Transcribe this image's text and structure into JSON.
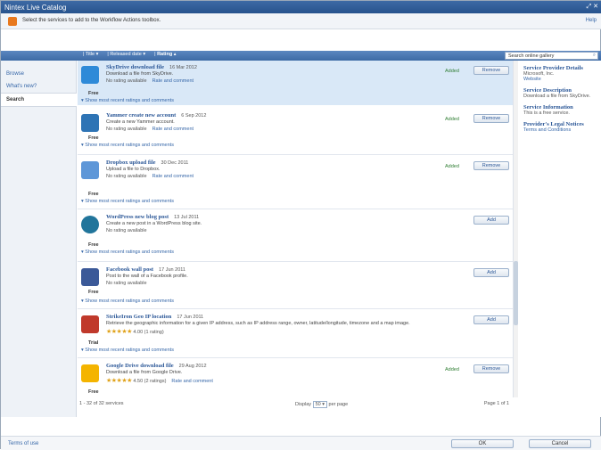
{
  "window": {
    "title": "Nintex Live Catalog",
    "instruction": "Select the services to add to the Workflow Actions toolbox.",
    "help": "Help"
  },
  "sort_bar": {
    "title": "Title",
    "released": "Released date",
    "rating": "Rating"
  },
  "search": {
    "placeholder": "Search online gallery"
  },
  "nav": [
    "Browse",
    "What's new?",
    "Search"
  ],
  "items": [
    {
      "name": "SkyDrive download file",
      "date": "16 Mar 2012",
      "desc": "Download a file from SkyDrive.",
      "rating_text": "No rating available",
      "rate_link": "Rate and comment",
      "price": "Free",
      "more": "Show most recent ratings and comments",
      "added": "Added",
      "button": "Remove",
      "color": "#2e8ad8"
    },
    {
      "name": "Yammer create new account",
      "date": "6 Sep 2012",
      "desc": "Create a new Yammer account.",
      "rating_text": "No rating available",
      "rate_link": "Rate and comment",
      "price": "Free",
      "more": "Show most recent ratings and comments",
      "added": "Added",
      "button": "Remove",
      "color": "#2e74b5"
    },
    {
      "name": "Dropbox upload file",
      "date": "30 Dec 2011",
      "desc": "Upload a file to Dropbox.",
      "rating_text": "No rating available",
      "rate_link": "Rate and comment",
      "price": "Free",
      "more": "Show most recent ratings and comments",
      "added": "Added",
      "button": "Remove",
      "color": "#5e97d8"
    },
    {
      "name": "WordPress new blog post",
      "date": "13 Jul 2011",
      "desc": "Create a new post in a WordPress blog site.",
      "rating_text": "No rating available",
      "rate_link": "",
      "price": "Free",
      "more": "Show most recent ratings and comments",
      "added": "",
      "button": "Add",
      "color": "#21759b"
    },
    {
      "name": "Facebook wall post",
      "date": "17 Jun 2011",
      "desc": "Post to the wall of a Facebook profile.",
      "rating_text": "No rating available",
      "rate_link": "",
      "price": "Free",
      "more": "Show most recent ratings and comments",
      "added": "",
      "button": "Add",
      "color": "#3b5998"
    },
    {
      "name": "StrikeIron Geo IP location",
      "date": "17 Jun 2011",
      "desc": "Retrieve the geographic information for a given IP address, such as IP address range, owner, latitude/longitude, timezone and a map image.",
      "rating_text": "4.00 (1 rating)",
      "stars": "★★★★★",
      "rate_link": "",
      "price": "Trial",
      "more": "Show most recent ratings and comments",
      "added": "",
      "button": "Add",
      "color": "#c0392b"
    },
    {
      "name": "Google Drive download file",
      "date": "29 Aug 2012",
      "desc": "Download a file from Google Drive.",
      "rating_text": "4.50 (2 ratings)",
      "stars": "★★★★★",
      "rate_link": "Rate and comment",
      "price": "Free",
      "more": "",
      "added": "Added",
      "button": "Remove",
      "color": "#f4b400"
    }
  ],
  "right_panel": {
    "provider_title": "Service Provider Details",
    "provider": "Microsoft, Inc.",
    "website": "Website",
    "desc_title": "Service Description",
    "desc": "Download a file from SkyDrive.",
    "info_title": "Service Information",
    "info": "This is a free service.",
    "legal_title": "Provider's Legal Notices",
    "legal": "Terms and Conditions"
  },
  "footer": {
    "count": "1 - 32 of 32 services",
    "display": "Display",
    "per_page_value": "50",
    "per_page": "per page",
    "page": "Page 1 of 1"
  },
  "bottom": {
    "terms": "Terms of use",
    "ok": "OK",
    "cancel": "Cancel"
  }
}
